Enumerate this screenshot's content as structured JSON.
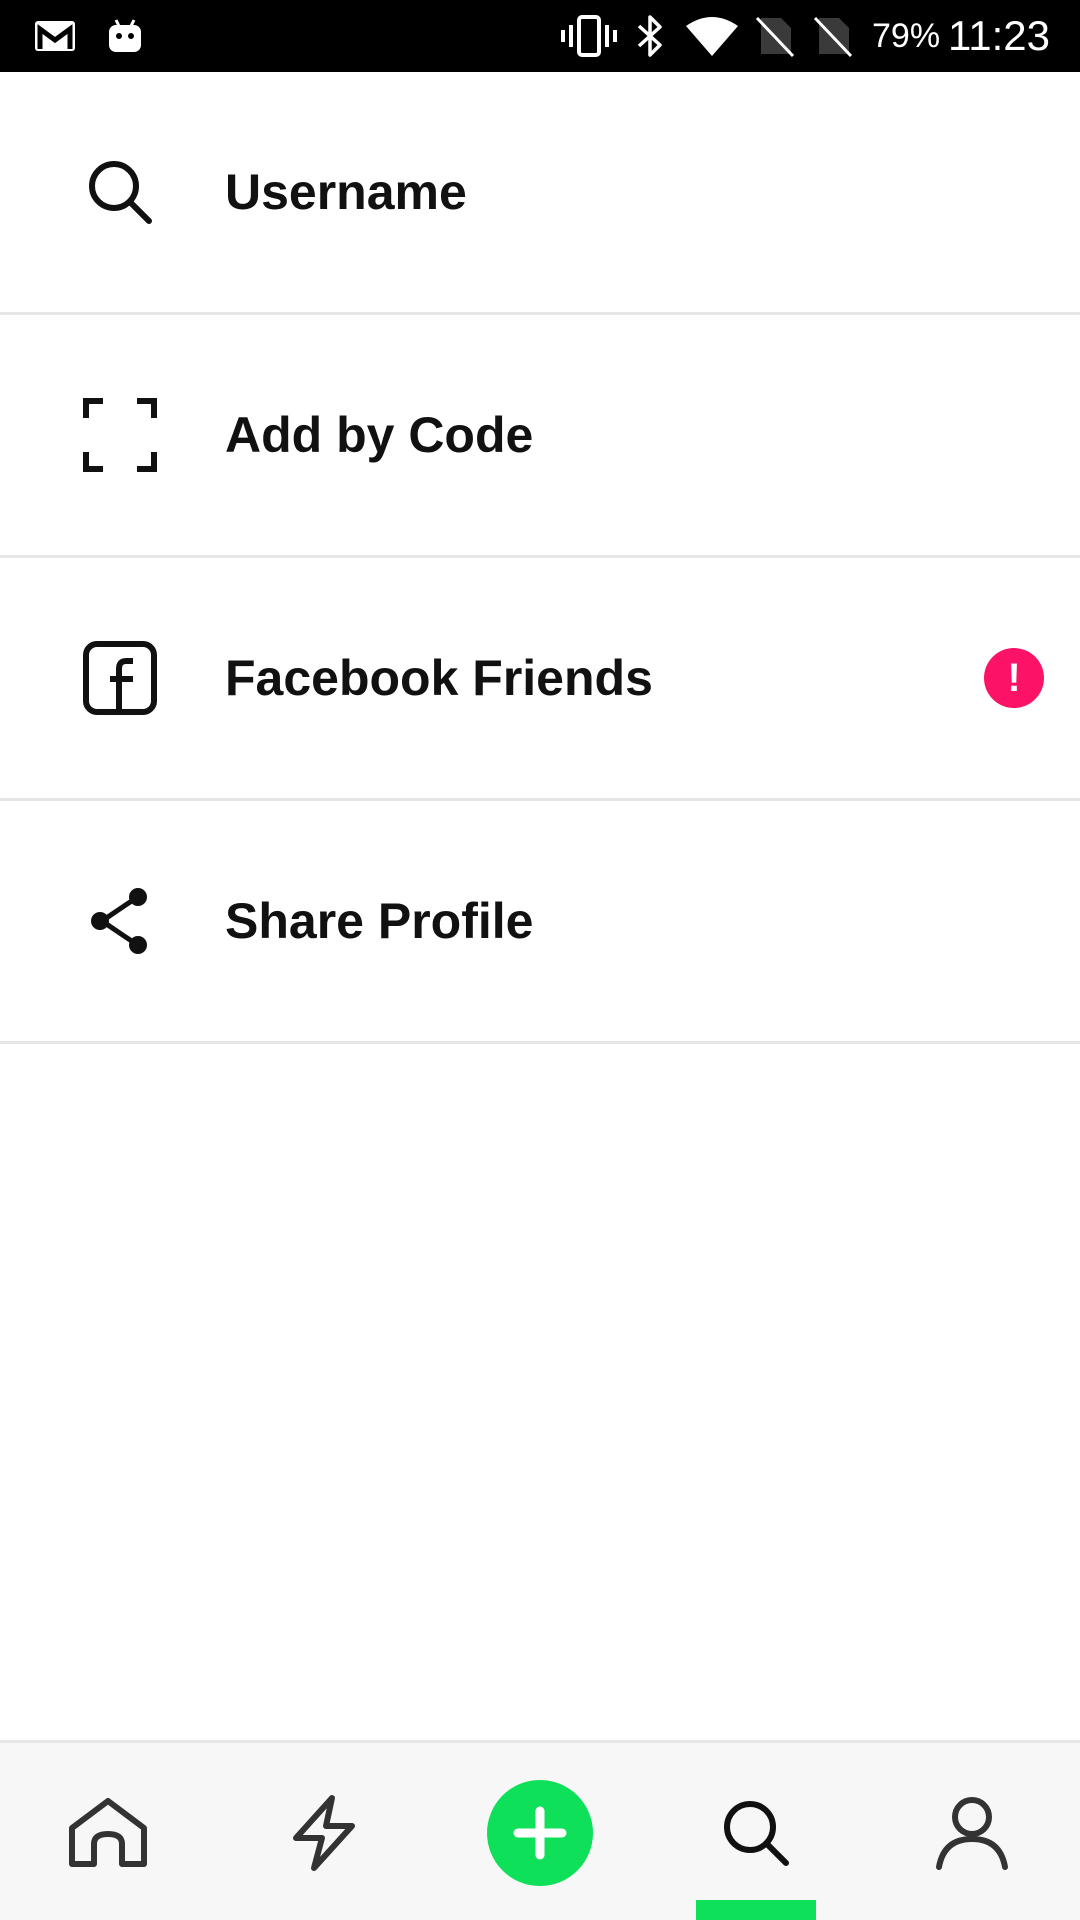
{
  "status_bar": {
    "battery": "79%",
    "time": "11:23",
    "icons": [
      "gmail-icon",
      "android-icon",
      "vibrate-icon",
      "bluetooth-icon",
      "wifi-icon",
      "no-sim-icon",
      "no-sim-icon"
    ]
  },
  "menu": {
    "items": [
      {
        "label": "Username",
        "icon": "search-icon"
      },
      {
        "label": "Add by Code",
        "icon": "scan-frame-icon"
      },
      {
        "label": "Facebook Friends",
        "icon": "facebook-icon",
        "alert": "!"
      },
      {
        "label": "Share Profile",
        "icon": "share-icon"
      }
    ]
  },
  "bottom_nav": {
    "items": [
      "home-icon",
      "lightning-icon",
      "plus-icon",
      "search-icon",
      "user-icon"
    ],
    "active": "search"
  },
  "colors": {
    "accent_green": "#0ee05a",
    "alert_pink": "#fc1267",
    "divider": "#e6e6e6",
    "text": "#111111",
    "nav_background": "#f7f7f7"
  }
}
